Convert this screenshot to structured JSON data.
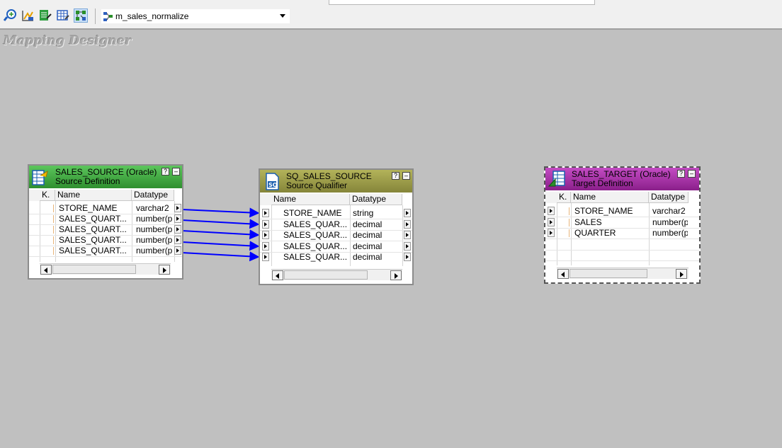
{
  "toolbar": {
    "buttons": [
      {
        "icon": "source-analyzer-icon"
      },
      {
        "icon": "target-designer-icon"
      },
      {
        "icon": "transformation-developer-icon"
      },
      {
        "icon": "mapplet-designer-icon"
      },
      {
        "icon": "mapping-designer-icon",
        "active": true
      }
    ],
    "mapping_select": {
      "icon": "mapping-icon",
      "value": "m_sales_normalize"
    }
  },
  "workspace": {
    "title": "Mapping Designer"
  },
  "source": {
    "title": "SALES_SOURCE (Oracle)",
    "subtitle": "Source Definition",
    "header_color": "#3fa33f",
    "columns": [
      "K.",
      "Name",
      "Datatype"
    ],
    "rows": [
      {
        "name": "STORE_NAME",
        "type": "varchar2"
      },
      {
        "name": "SALES_QUART...",
        "type": "number(p"
      },
      {
        "name": "SALES_QUART...",
        "type": "number(p"
      },
      {
        "name": "SALES_QUART...",
        "type": "number(p"
      },
      {
        "name": "SALES_QUART...",
        "type": "number(p"
      }
    ],
    "help_label": "?",
    "min_label": "–"
  },
  "qualifier": {
    "title": "SQ_SALES_SOURCE",
    "subtitle": "Source Qualifier",
    "header_color": "#9b9b4a",
    "columns": [
      "Name",
      "Datatype"
    ],
    "rows": [
      {
        "name": "STORE_NAME",
        "type": "string"
      },
      {
        "name": "SALES_QUAR...",
        "type": "decimal"
      },
      {
        "name": "SALES_QUAR...",
        "type": "decimal"
      },
      {
        "name": "SALES_QUAR...",
        "type": "decimal"
      },
      {
        "name": "SALES_QUAR...",
        "type": "decimal"
      }
    ],
    "help_label": "?",
    "min_label": "–"
  },
  "target": {
    "title": "SALES_TARGET (Oracle)",
    "subtitle": "Target Definition",
    "header_color": "#a235a2",
    "columns": [
      "K.",
      "Name",
      "Datatype"
    ],
    "rows": [
      {
        "name": "STORE_NAME",
        "type": "varchar2"
      },
      {
        "name": "SALES",
        "type": "number(p"
      },
      {
        "name": "QUARTER",
        "type": "number(p"
      }
    ],
    "help_label": "?",
    "min_label": "–"
  },
  "links": {
    "color": "#0000ff",
    "count": 5
  }
}
